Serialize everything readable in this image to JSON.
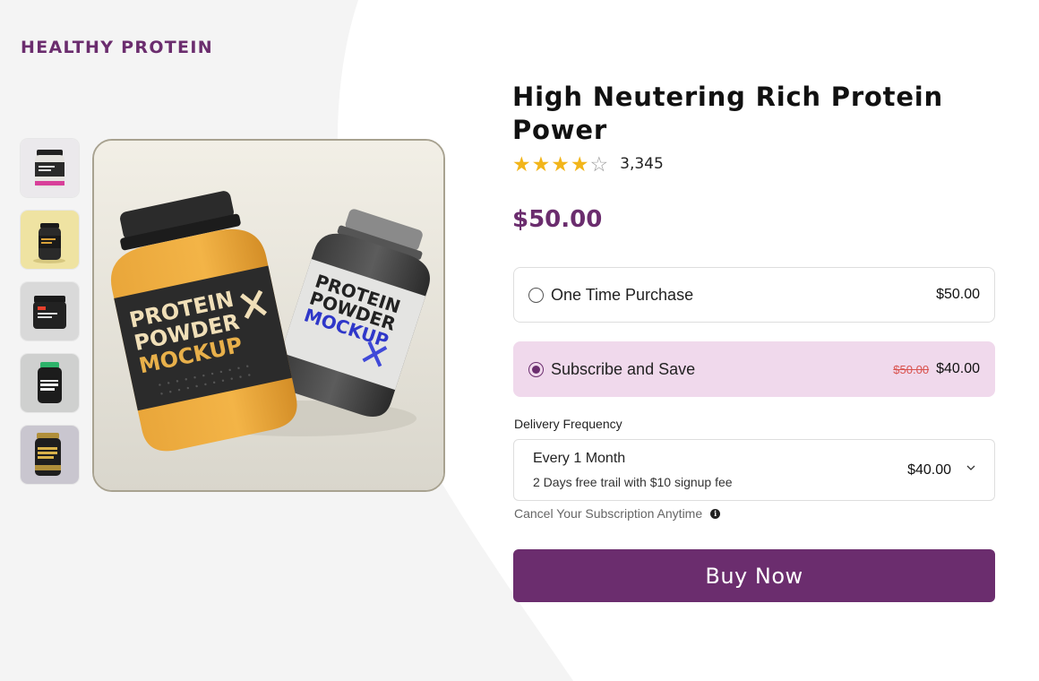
{
  "brand": "HEALTHY PROTEIN",
  "product": {
    "title": "High Neutering Rich Protein Power",
    "rating": 4,
    "rating_max": 5,
    "rating_count": "3,345",
    "price": "$50.00",
    "main_image_text": {
      "jar_1_lines": [
        "PROTEIN",
        "POWDER",
        "MOCKUP"
      ],
      "jar_2_lines": [
        "PROTEIN",
        "POWDER",
        "MOCKUP"
      ]
    }
  },
  "thumbnails": [
    {
      "name": "thumb-1",
      "jar_color": "#e8e6e2",
      "bg": "#e9e7ea",
      "band": "#2b2b2b",
      "accent": "#d8409a"
    },
    {
      "name": "thumb-2",
      "jar_color": "#2a2a2a",
      "bg": "#efe3a2",
      "band": "#2a2a2a",
      "accent": "#d9a23a"
    },
    {
      "name": "thumb-3",
      "jar_color": "#222222",
      "bg": "#d9d9d9",
      "band": "#2a2a2a",
      "accent": "#e8402c"
    },
    {
      "name": "thumb-4",
      "jar_color": "#1c1c1c",
      "bg": "#cfd0cf",
      "band": "#1c1c1c",
      "accent": "#2db36a"
    },
    {
      "name": "thumb-5",
      "jar_color": "#1e1e1e",
      "bg": "#c9c6cf",
      "band": "#1e1e1e",
      "accent": "#d9b24a"
    }
  ],
  "purchase_options": {
    "one_time": {
      "label": "One Time Purchase",
      "price": "$50.00",
      "selected": false
    },
    "subscribe": {
      "label": "Subscribe and Save",
      "old_price": "$50.00",
      "price": "$40.00",
      "selected": true
    }
  },
  "delivery": {
    "label": "Delivery Frequency",
    "selected": "Every 1 Month",
    "subtext": "2 Days free trail with $10 signup fee",
    "price": "$40.00"
  },
  "cancel_note": "Cancel Your Subscription Anytime",
  "buy_button": "Buy Now",
  "colors": {
    "brand": "#6b2d6e",
    "subscribe_bg": "#f0d9ec",
    "star": "#f2b51a",
    "strike": "#d9534f"
  },
  "icons": {
    "star": "star-icon",
    "info": "info-icon",
    "chevron": "chevron-down-icon"
  }
}
